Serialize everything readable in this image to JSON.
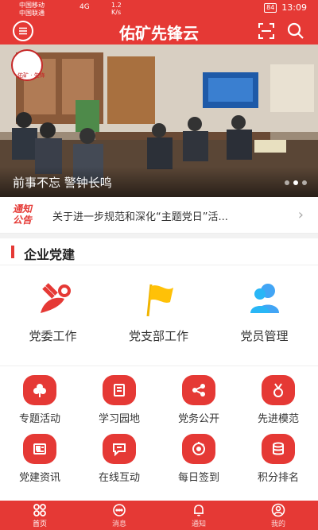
{
  "status_bar": {
    "carrier1": "中国移动",
    "carrier2": "中国联通",
    "network": "4G",
    "speed_value": "1.2",
    "speed_unit": "K/s",
    "battery": "84",
    "time": "13:09"
  },
  "header": {
    "title": "佑矿先锋云",
    "menu_icon": "menu-icon",
    "scan_icon": "scan-icon",
    "search_icon": "search-icon"
  },
  "banner": {
    "caption": "前事不忘 警钟长鸣",
    "logo_text": "佑矿 · 先锋",
    "slide_count": 3,
    "active_slide": 2
  },
  "notice": {
    "badge": "通知公告",
    "text": "关于进一步规范和深化“主题党日”活..."
  },
  "section": {
    "title": "企业党建",
    "main_items": [
      {
        "label": "党委工作",
        "icon": "party-emblem-icon"
      },
      {
        "label": "党支部工作",
        "icon": "flag-icon"
      },
      {
        "label": "党员管理",
        "icon": "members-icon"
      }
    ],
    "grid_items": [
      {
        "label": "专题活动",
        "icon": "clover-icon"
      },
      {
        "label": "学习园地",
        "icon": "book-icon"
      },
      {
        "label": "党务公开",
        "icon": "share-icon"
      },
      {
        "label": "先进模范",
        "icon": "medal-icon"
      },
      {
        "label": "党建资讯",
        "icon": "newspaper-icon"
      },
      {
        "label": "在线互动",
        "icon": "chat-icon"
      },
      {
        "label": "每日签到",
        "icon": "checkin-icon"
      },
      {
        "label": "积分排名",
        "icon": "coins-icon"
      }
    ]
  },
  "tabbar": {
    "items": [
      {
        "label": "首页",
        "icon": "home-grid-icon",
        "active": true
      },
      {
        "label": "消息",
        "icon": "message-icon",
        "active": false
      },
      {
        "label": "通知",
        "icon": "bell-icon",
        "active": false
      },
      {
        "label": "我的",
        "icon": "user-icon",
        "active": false
      }
    ]
  },
  "colors": {
    "brand_red": "#e53935"
  }
}
